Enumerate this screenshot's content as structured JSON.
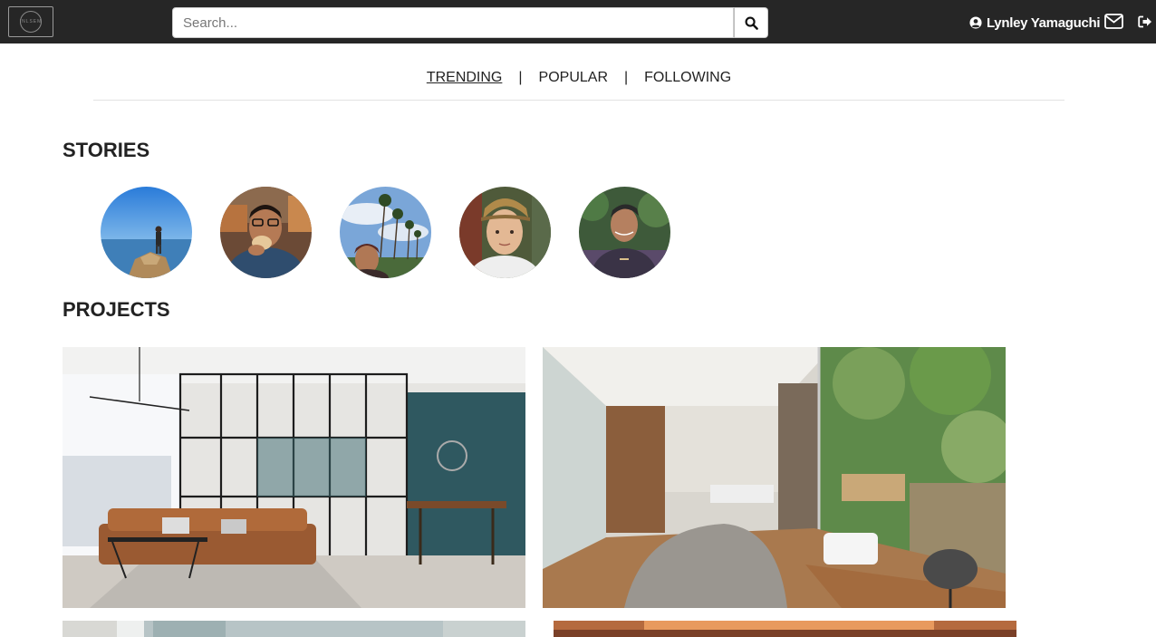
{
  "header": {
    "logo_text": "INLSEM",
    "search": {
      "placeholder": "Search...",
      "value": ""
    },
    "user_name": "Lynley Yamaguchi"
  },
  "tabs": [
    {
      "label": "TRENDING",
      "active": true
    },
    {
      "label": "POPULAR",
      "active": false
    },
    {
      "label": "FOLLOWING",
      "active": false
    }
  ],
  "tab_separator": "|",
  "stories": {
    "title": "STORIES"
  },
  "projects": {
    "title": "PROJECTS"
  },
  "colors": {
    "topbar": "#262626",
    "text": "#222222",
    "divider": "#e2e2e2"
  }
}
